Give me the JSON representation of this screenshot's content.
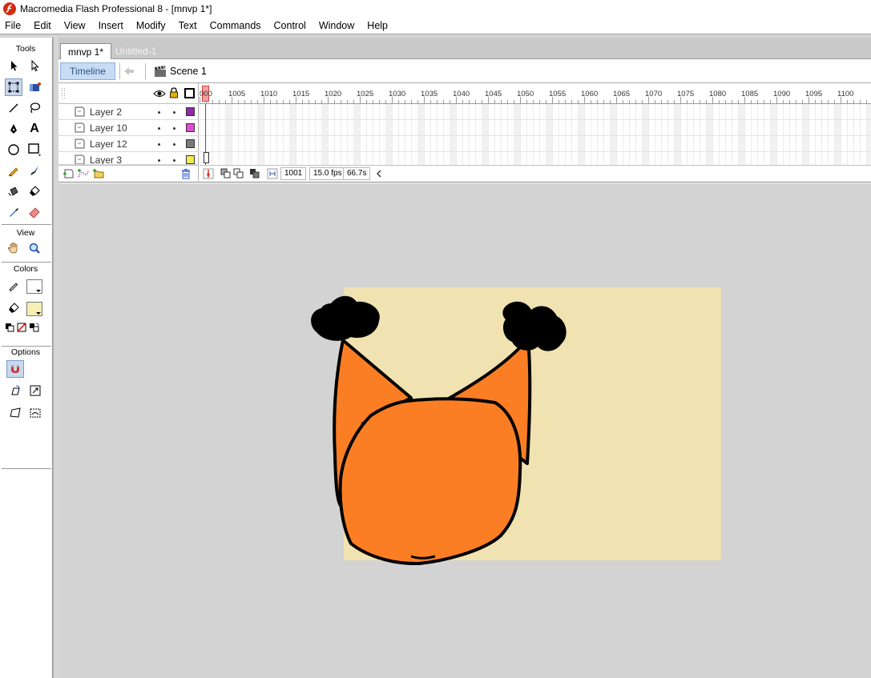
{
  "window": {
    "title": "Macromedia Flash Professional 8 - [mnvp 1*]"
  },
  "menu": [
    "File",
    "Edit",
    "View",
    "Insert",
    "Modify",
    "Text",
    "Commands",
    "Control",
    "Window",
    "Help"
  ],
  "tools_panel": {
    "tools_heading": "Tools",
    "view_heading": "View",
    "colors_heading": "Colors",
    "options_heading": "Options",
    "stroke_color": "#ffffff",
    "fill_color": "#f6efb4"
  },
  "doc_tabs": [
    {
      "label": "mnvp 1*",
      "active": true
    },
    {
      "label": "Untitled-1",
      "active": false
    }
  ],
  "edit_bar": {
    "timeline_label": "Timeline",
    "scene_label": "Scene 1"
  },
  "timeline": {
    "layers": [
      {
        "name": "Layer 2",
        "color": "#8e2aa8"
      },
      {
        "name": "Layer 10",
        "color": "#e24cd6"
      },
      {
        "name": "Layer 12",
        "color": "#7a7a7a"
      },
      {
        "name": "Layer 3",
        "color": "#f2ee52"
      }
    ],
    "ruler_labels": [
      "000",
      "1005",
      "1010",
      "1015",
      "1020",
      "1025",
      "1030",
      "1035",
      "1040",
      "1045",
      "1050",
      "1055",
      "1060",
      "1065",
      "1070",
      "1075",
      "1080",
      "1085",
      "1090",
      "1095",
      "1100"
    ],
    "current_frame": "1001",
    "frame_rate": "15.0 fps",
    "elapsed_time": "66.7s"
  },
  "stage": {
    "background_color": "#f0e2b1",
    "area_color": "#d3d3d3"
  }
}
